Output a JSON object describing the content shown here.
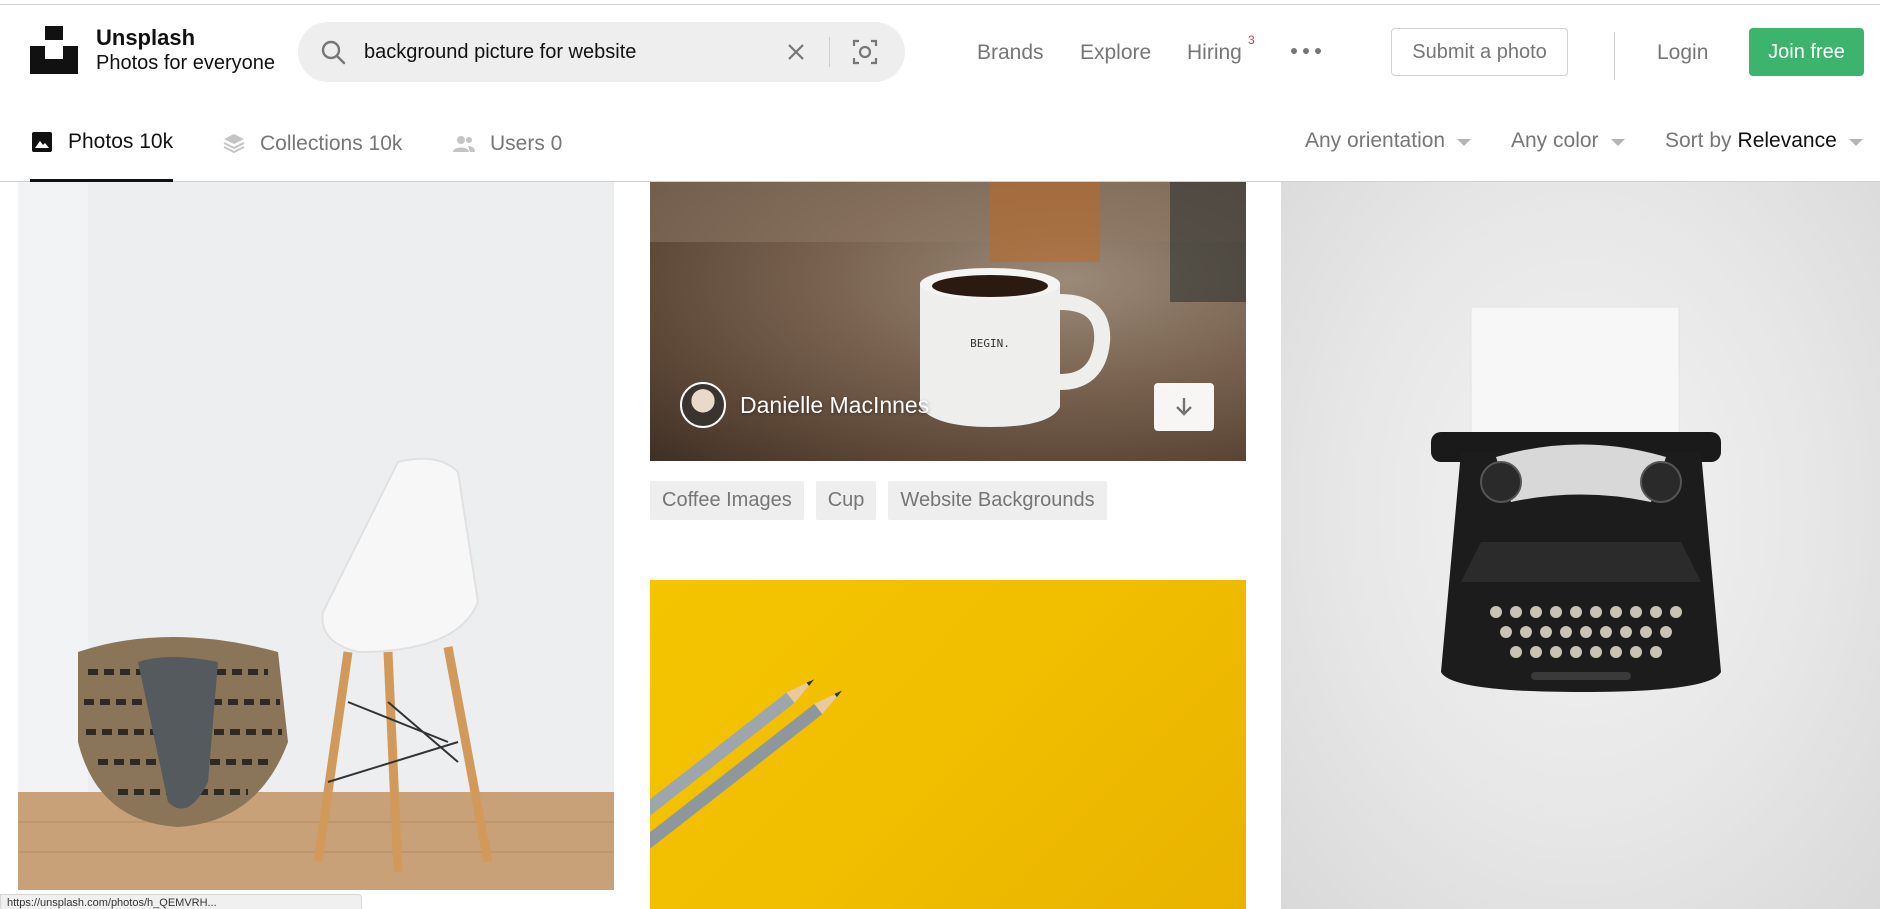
{
  "brand": {
    "title": "Unsplash",
    "subtitle": "Photos for everyone"
  },
  "search": {
    "value": "background picture for website"
  },
  "nav": {
    "brands": "Brands",
    "explore": "Explore",
    "hiring": "Hiring",
    "hiring_badge": "3"
  },
  "header": {
    "submit": "Submit a photo",
    "login": "Login",
    "join": "Join free"
  },
  "tabs": [
    {
      "label": "Photos 10k",
      "icon": "photo-icon",
      "active": true
    },
    {
      "label": "Collections 10k",
      "icon": "collections-icon",
      "active": false
    },
    {
      "label": "Users 0",
      "icon": "users-icon",
      "active": false
    }
  ],
  "filters": {
    "orientation": "Any orientation",
    "color": "Any color",
    "sort_prefix": "Sort by",
    "sort_value": "Relevance"
  },
  "photos": {
    "mug": {
      "photographer": "Danielle MacInnes",
      "mug_text": "BEGIN.",
      "tags": [
        "Coffee Images",
        "Cup",
        "Website Backgrounds"
      ]
    }
  },
  "status_bar": {
    "url": "https://unsplash.com/photos/h_QEMVRH..."
  },
  "colors": {
    "join_green": "#3cb46e",
    "badge_pink": "#d33c5a",
    "muted_text": "#767676"
  }
}
